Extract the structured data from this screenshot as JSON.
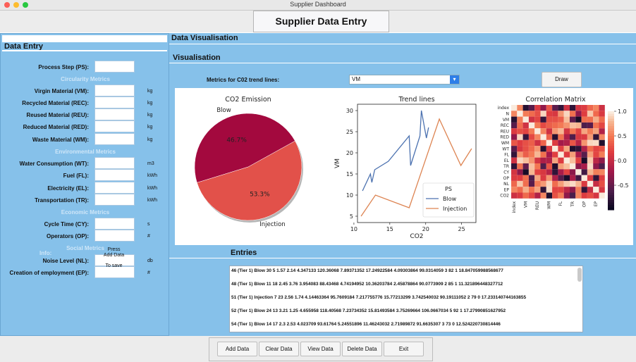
{
  "window": {
    "title": "Supplier Dashboard"
  },
  "header": {
    "title": "Supplier Data Entry"
  },
  "left": {
    "title": "Data Entry",
    "process_step": "Process Step (PS):",
    "sections": {
      "circularity": "Circularity Metrics",
      "environmental": "Environmental Metrics",
      "economic": "Economic Metrics",
      "social": "Social Metrics"
    },
    "fields": {
      "vm": {
        "label": "Virgin Material (VM):",
        "unit": "kg"
      },
      "rec": {
        "label": "Recycled Material (REC):",
        "unit": "kg"
      },
      "reu": {
        "label": "Reused Material (REU):",
        "unit": "kg"
      },
      "red": {
        "label": "Reduced Material (RED):",
        "unit": "kg"
      },
      "wm": {
        "label": "Waste Material (WM):",
        "unit": "kg"
      },
      "wt": {
        "label": "Water Consumption (WT):",
        "unit": "m3"
      },
      "fl": {
        "label": "Fuel (FL):",
        "unit": "kWh"
      },
      "el": {
        "label": "Electricity (EL):",
        "unit": "kWh"
      },
      "tr": {
        "label": "Transportation (TR):",
        "unit": "kWh"
      },
      "cy": {
        "label": "Cycle Time (CY):",
        "unit": "s"
      },
      "op": {
        "label": "Operators (OP):",
        "unit": "#"
      },
      "nl": {
        "label": "Noise Level (NL):",
        "unit": "db"
      },
      "ep": {
        "label": "Creation of employment (EP):",
        "unit": "#"
      }
    },
    "info": {
      "label": "Info:",
      "line1": "Press",
      "line2": "Add Data",
      "line3": "To save"
    }
  },
  "visual": {
    "section_title": "Data Visualisation",
    "sub_title": "Visualisation",
    "metric_label": "Metrics for C02 trend lines:",
    "metric_value": "VM",
    "draw": "Draw"
  },
  "chart_data": [
    {
      "type": "pie",
      "title": "CO2 Emission",
      "labels": [
        "Blow",
        "Injection"
      ],
      "values": [
        46.7,
        53.3
      ],
      "value_labels": [
        "46.7%",
        "53.3%"
      ],
      "colors": [
        "#a3093e",
        "#e2514a"
      ]
    },
    {
      "type": "line",
      "title": "Trend lines",
      "xlabel": "CO2",
      "ylabel": "VM",
      "xlim": [
        10.5,
        27
      ],
      "ylim": [
        3.5,
        31.5
      ],
      "xticks": [
        10,
        15,
        20,
        25
      ],
      "yticks": [
        5,
        10,
        15,
        20,
        25,
        30
      ],
      "legend_title": "PS",
      "legend_position": "lower-right",
      "series": [
        {
          "name": "Blow",
          "color": "#4c72b0",
          "points": [
            [
              11.2,
              11
            ],
            [
              12.3,
              15
            ],
            [
              12.5,
              13
            ],
            [
              12.9,
              16
            ],
            [
              14.8,
              18
            ],
            [
              17.7,
              24
            ],
            [
              17.9,
              17
            ],
            [
              19.2,
              24
            ],
            [
              19.4,
              30
            ],
            [
              20.1,
              23.5
            ],
            [
              20.4,
              26
            ]
          ]
        },
        {
          "name": "Injection",
          "color": "#dd8452",
          "points": [
            [
              11.0,
              5
            ],
            [
              13.0,
              10
            ],
            [
              17.7,
              7
            ],
            [
              21.9,
              28
            ],
            [
              24.9,
              17
            ],
            [
              26.4,
              21
            ]
          ]
        }
      ]
    },
    {
      "type": "heatmap",
      "title": "Correlation Matrix",
      "row_labels": [
        "index",
        "N",
        "VM",
        "REC",
        "REU",
        "RED",
        "WM",
        "WT",
        "FL",
        "EL",
        "TR",
        "CY",
        "OP",
        "NL",
        "EP",
        "CO2"
      ],
      "col_labels": [
        "index",
        "VM",
        "REU",
        "WM",
        "FL",
        "TR",
        "OP",
        "EP"
      ],
      "colorbar_ticks": [
        "1.0",
        "0.5",
        "0.0",
        "-0.5"
      ],
      "vmin": -1,
      "vmax": 1
    }
  ],
  "entries": {
    "title": "Entries",
    "rows": [
      "46 (Tier 1) Blow 30 5 1.57 2.14 4.347133 120.36068 7.89371352 17.24922584 4.09303864 99.0314059 3 82 1 18.847059988568677",
      "48 (Tier 1) Blow 11 18 2.45 3.76 3.954083 88.43468 4.74194952 10.36203784 2.45878864 90.0773909 2 85 1 11.321896448327712",
      "51 (Tier 1) Injection 7 23 2.56 1.74 4.14463364 95.7609184 7.217755776 15.77213299 3.742540032 90.19111052 2 79 0 17.233140744163855",
      "52 (Tier 1) Blow 24 13 3.21 1.25 4.655958 118.40568 7.23734352 15.81493584 3.75269664 106.0667034 5 92 1 17.27990851627952",
      "54 (Tier 1) Blow 14 17 2.3 2.53 4.023709 93.61764 5.24551896 11.46243032 2.71989872 91.6635307 3 73 0 12.524220730814446"
    ]
  },
  "buttons": {
    "add": "Add Data",
    "clear": "Clear Data",
    "view": "View Data",
    "delete": "Delete Data",
    "exit": "Exit"
  }
}
